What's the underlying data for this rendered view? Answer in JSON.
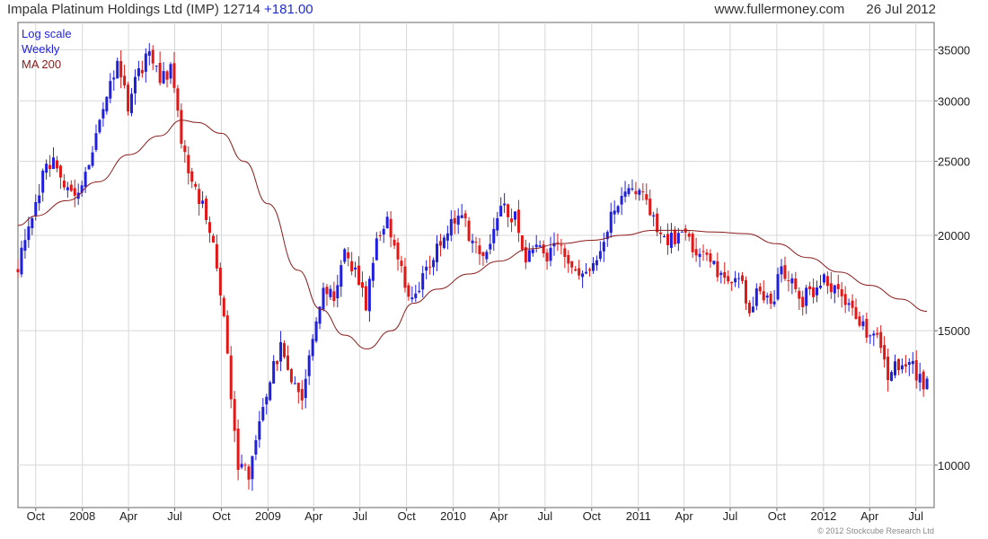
{
  "header": {
    "instrument": "Impala Platinum Holdings Ltd (IMP)",
    "price": "12714",
    "change": "+181.00",
    "source": "www.fullermoney.com",
    "date": "26 Jul 2012"
  },
  "legend": {
    "scale": "Log scale",
    "frequency": "Weekly",
    "ma_label": "MA 200"
  },
  "copyright": "© 2012 Stockcube Research Ltd",
  "colors": {
    "up": "#1f1fe0",
    "down": "#e01818",
    "ma": "#8b1a1a",
    "grid": "#d8d8d8",
    "axis": "#666666",
    "header_change": "#1f2ad8"
  },
  "chart_data": {
    "type": "candlestick",
    "scale": "log",
    "frequency": "weekly",
    "y_ticks": [
      10000,
      15000,
      20000,
      25000,
      30000,
      35000
    ],
    "y_tick_labels": [
      "10000",
      "15000",
      "20000",
      "25000",
      "30000",
      "35000"
    ],
    "ylim": [
      8800,
      38000
    ],
    "x_range": [
      "2007-08-27",
      "2012-08-06"
    ],
    "x_ticks": [
      {
        "label": "Oct",
        "date": "2007-10-01"
      },
      {
        "label": "2008",
        "date": "2008-01-01"
      },
      {
        "label": "Apr",
        "date": "2008-04-01"
      },
      {
        "label": "Jul",
        "date": "2008-07-01"
      },
      {
        "label": "Oct",
        "date": "2008-10-01"
      },
      {
        "label": "2009",
        "date": "2009-01-01"
      },
      {
        "label": "Apr",
        "date": "2009-04-01"
      },
      {
        "label": "Jul",
        "date": "2009-07-01"
      },
      {
        "label": "Oct",
        "date": "2009-10-01"
      },
      {
        "label": "2010",
        "date": "2010-01-01"
      },
      {
        "label": "Apr",
        "date": "2010-04-01"
      },
      {
        "label": "Jul",
        "date": "2010-07-01"
      },
      {
        "label": "Oct",
        "date": "2010-10-01"
      },
      {
        "label": "2011",
        "date": "2011-01-01"
      },
      {
        "label": "Apr",
        "date": "2011-04-01"
      },
      {
        "label": "Jul",
        "date": "2011-07-01"
      },
      {
        "label": "Oct",
        "date": "2011-10-01"
      },
      {
        "label": "2012",
        "date": "2012-01-01"
      },
      {
        "label": "Apr",
        "date": "2012-04-01"
      },
      {
        "label": "Jul",
        "date": "2012-07-01"
      }
    ],
    "close_anchors": [
      [
        "2007-08-27",
        18000
      ],
      [
        "2007-09-17",
        20500
      ],
      [
        "2007-10-15",
        24000
      ],
      [
        "2007-11-05",
        25500
      ],
      [
        "2007-11-26",
        23000
      ],
      [
        "2007-12-17",
        22500
      ],
      [
        "2008-01-07",
        24500
      ],
      [
        "2008-01-28",
        27000
      ],
      [
        "2008-02-18",
        31000
      ],
      [
        "2008-03-10",
        33500
      ],
      [
        "2008-03-31",
        29500
      ],
      [
        "2008-04-21",
        32500
      ],
      [
        "2008-05-12",
        34500
      ],
      [
        "2008-06-02",
        32000
      ],
      [
        "2008-06-23",
        33000
      ],
      [
        "2008-07-14",
        27000
      ],
      [
        "2008-08-04",
        23500
      ],
      [
        "2008-08-25",
        22000
      ],
      [
        "2008-09-15",
        19500
      ],
      [
        "2008-10-06",
        16000
      ],
      [
        "2008-10-20",
        12500
      ],
      [
        "2008-11-03",
        10000
      ],
      [
        "2008-11-24",
        9800
      ],
      [
        "2008-12-15",
        11500
      ],
      [
        "2009-01-05",
        13000
      ],
      [
        "2009-01-26",
        14200
      ],
      [
        "2009-02-16",
        13000
      ],
      [
        "2009-03-09",
        12000
      ],
      [
        "2009-03-30",
        15000
      ],
      [
        "2009-04-20",
        17000
      ],
      [
        "2009-05-11",
        16500
      ],
      [
        "2009-06-01",
        19000
      ],
      [
        "2009-06-22",
        18000
      ],
      [
        "2009-07-13",
        16200
      ],
      [
        "2009-08-03",
        19500
      ],
      [
        "2009-08-24",
        20800
      ],
      [
        "2009-09-14",
        19000
      ],
      [
        "2009-10-05",
        16500
      ],
      [
        "2009-10-26",
        17000
      ],
      [
        "2009-11-16",
        18500
      ],
      [
        "2009-12-07",
        19500
      ],
      [
        "2009-12-28",
        21000
      ],
      [
        "2010-01-18",
        21500
      ],
      [
        "2010-02-08",
        19500
      ],
      [
        "2010-03-01",
        19000
      ],
      [
        "2010-03-22",
        20500
      ],
      [
        "2010-04-12",
        22000
      ],
      [
        "2010-05-03",
        21000
      ],
      [
        "2010-05-24",
        18500
      ],
      [
        "2010-06-14",
        19500
      ],
      [
        "2010-07-05",
        18500
      ],
      [
        "2010-07-26",
        19800
      ],
      [
        "2010-08-16",
        18500
      ],
      [
        "2010-09-06",
        17500
      ],
      [
        "2010-09-27",
        18000
      ],
      [
        "2010-10-18",
        19500
      ],
      [
        "2010-11-08",
        21000
      ],
      [
        "2010-11-29",
        22500
      ],
      [
        "2010-12-20",
        23500
      ],
      [
        "2011-01-10",
        22500
      ],
      [
        "2011-01-31",
        21000
      ],
      [
        "2011-02-21",
        20000
      ],
      [
        "2011-03-14",
        19500
      ],
      [
        "2011-04-04",
        20500
      ],
      [
        "2011-04-25",
        19000
      ],
      [
        "2011-05-16",
        18500
      ],
      [
        "2011-06-06",
        18000
      ],
      [
        "2011-06-27",
        17200
      ],
      [
        "2011-07-18",
        17800
      ],
      [
        "2011-08-08",
        16000
      ],
      [
        "2011-08-29",
        17000
      ],
      [
        "2011-09-19",
        16200
      ],
      [
        "2011-10-10",
        18000
      ],
      [
        "2011-10-31",
        17500
      ],
      [
        "2011-11-21",
        16500
      ],
      [
        "2011-12-12",
        17000
      ],
      [
        "2012-01-02",
        17500
      ],
      [
        "2012-01-23",
        16800
      ],
      [
        "2012-02-13",
        16200
      ],
      [
        "2012-03-05",
        15500
      ],
      [
        "2012-03-26",
        15000
      ],
      [
        "2012-04-16",
        14600
      ],
      [
        "2012-05-07",
        13200
      ],
      [
        "2012-05-28",
        13600
      ],
      [
        "2012-06-18",
        13900
      ],
      [
        "2012-07-09",
        12900
      ],
      [
        "2012-07-23",
        12714
      ]
    ],
    "ma_series": {
      "name": "MA 200",
      "points": [
        [
          "2007-08-27",
          20600
        ],
        [
          "2007-10-01",
          21200
        ],
        [
          "2007-12-01",
          22200
        ],
        [
          "2008-02-01",
          23500
        ],
        [
          "2008-04-01",
          25500
        ],
        [
          "2008-06-01",
          27000
        ],
        [
          "2008-07-15",
          28300
        ],
        [
          "2008-08-15",
          28100
        ],
        [
          "2008-10-01",
          27200
        ],
        [
          "2008-11-15",
          25000
        ],
        [
          "2009-01-01",
          22000
        ],
        [
          "2009-03-01",
          18000
        ],
        [
          "2009-04-15",
          16000
        ],
        [
          "2009-06-01",
          14800
        ],
        [
          "2009-07-15",
          14200
        ],
        [
          "2009-09-01",
          15000
        ],
        [
          "2009-10-15",
          16300
        ],
        [
          "2009-12-01",
          17000
        ],
        [
          "2010-02-01",
          17800
        ],
        [
          "2010-04-01",
          18500
        ],
        [
          "2010-06-01",
          19200
        ],
        [
          "2010-08-01",
          19500
        ],
        [
          "2010-10-01",
          19700
        ],
        [
          "2010-12-01",
          20000
        ],
        [
          "2011-02-01",
          20300
        ],
        [
          "2011-04-01",
          20300
        ],
        [
          "2011-06-01",
          20200
        ],
        [
          "2011-08-01",
          20100
        ],
        [
          "2011-10-01",
          19500
        ],
        [
          "2011-12-01",
          18700
        ],
        [
          "2012-02-01",
          17900
        ],
        [
          "2012-04-01",
          17200
        ],
        [
          "2012-06-01",
          16500
        ],
        [
          "2012-07-23",
          15900
        ]
      ]
    }
  }
}
